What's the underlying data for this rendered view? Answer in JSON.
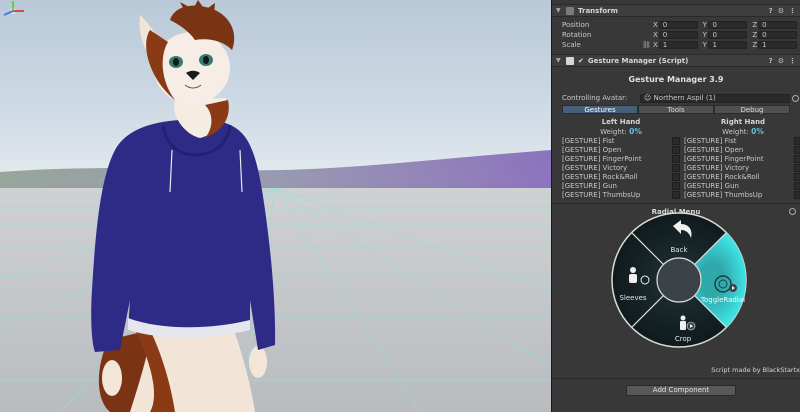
{
  "transform": {
    "title": "Transform",
    "rows": [
      {
        "label": "Position",
        "x": "0",
        "y": "0",
        "z": "0"
      },
      {
        "label": "Rotation",
        "x": "0",
        "y": "0",
        "z": "0"
      },
      {
        "label": "Scale",
        "x": "1",
        "y": "1",
        "z": "1"
      }
    ],
    "axes": {
      "x": "X",
      "y": "Y",
      "z": "Z"
    }
  },
  "gesture_manager": {
    "header": "Gesture Manager (Script)",
    "title": "Gesture Manager 3.9",
    "controlling_label": "Controlling Avatar:",
    "avatar_name": "Northern Aspil (1)",
    "tabs": [
      "Gestures",
      "Tools",
      "Debug"
    ],
    "left": {
      "title": "Left Hand",
      "weight_label": "Weight:",
      "weight_value": "0%"
    },
    "right": {
      "title": "Right Hand",
      "weight_label": "Weight:",
      "weight_value": "0%"
    },
    "gestures": [
      "[GESTURE] Fist",
      "[GESTURE] Open",
      "[GESTURE] FingerPoint",
      "[GESTURE] Victory",
      "[GESTURE] Rock&Roll",
      "[GESTURE] Gun",
      "[GESTURE] ThumbsUp"
    ],
    "radial_title": "Radial Menu",
    "radial": {
      "back": "Back",
      "sleeves": "Sleeves",
      "toggle": "ToggleRadial",
      "crop": "Crop",
      "accent": "#35d6d8"
    },
    "credit": "Script made by BlackStartx",
    "add_component": "Add Component"
  }
}
